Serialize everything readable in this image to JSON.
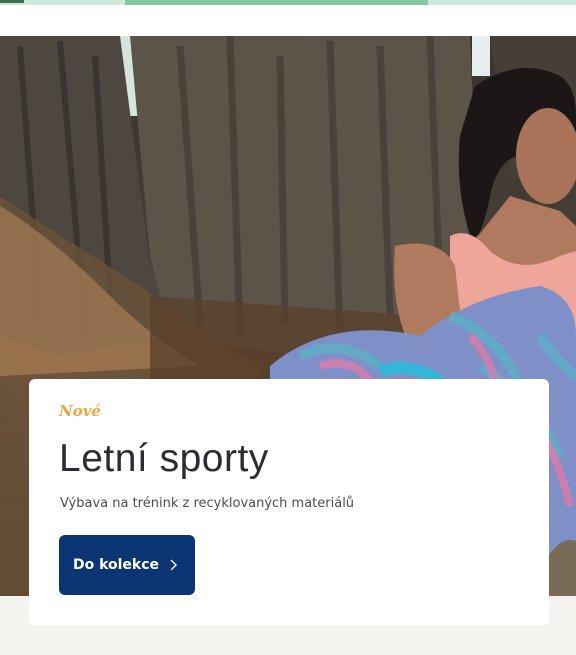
{
  "hero": {
    "image_description_icon": "hero-photo-woman-forest",
    "card": {
      "badge": "Nové",
      "title": "Letní sporty",
      "subtitle": "Výbava na trénink z recyklovaných materiálů",
      "cta_label": "Do kolekce",
      "cta_icon": "chevron-right-icon"
    }
  },
  "colors": {
    "badge": "#efa23f",
    "cta_background": "#0b3472",
    "title": "#2a2d35",
    "page_background": "#f5f3ef",
    "top_accent": "#86c7a4"
  }
}
